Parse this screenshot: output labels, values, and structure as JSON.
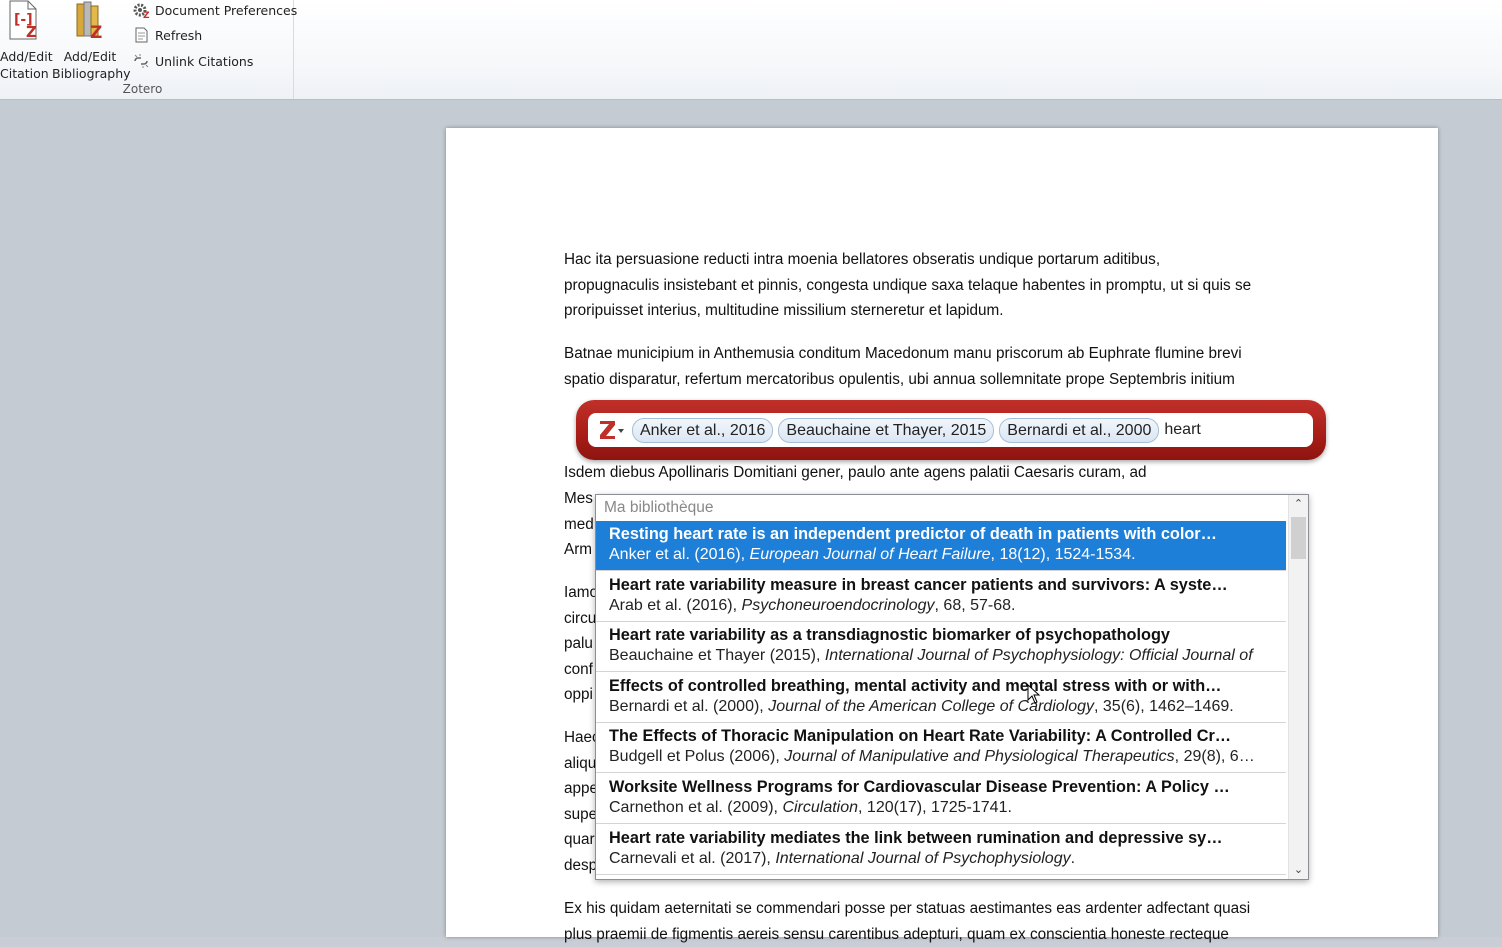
{
  "ribbon": {
    "add_citation": [
      "Add/Edit",
      "Citation"
    ],
    "add_bibliography": [
      "Add/Edit",
      "Bibliography"
    ],
    "document_preferences": "Document Preferences",
    "refresh": "Refresh",
    "unlink_citations": "Unlink Citations",
    "group_label": "Zotero"
  },
  "document": {
    "paragraphs": [
      [
        "Hac ita persuasione reducti intra moenia bellatores obseratis undique portarum aditibus,",
        "propugnaculis insistebant et pinnis, congesta undique saxa telaque habentes in promptu, ut si quis se",
        "proripuisset interius, multitudine missilium sterneretur et lapidum."
      ],
      [
        "Batnae municipium in Anthemusia conditum Macedonum manu priscorum ab Euphrate flumine brevi",
        "spatio disparatur, refertum mercatoribus opulentis, ubi annua sollemnitate prope Septembris initium"
      ],
      [
        "Isdem diebus Apollinaris Domitiani gener, paulo ante agens palatii Caesaris curam, ad"
      ],
      [
        "Ex his quidam aeternitati se commendari posse per statuas aestimantes eas ardenter adfectant quasi",
        "plus praemii de figmentis aereis sensu carentibus adepturi, quam ex conscientia honeste recteque"
      ]
    ],
    "left_fragments": [
      "Mes",
      "med",
      "Arm",
      "Iamo",
      "circu",
      "palu",
      "conf",
      "oppi",
      "Haec",
      "aliqu",
      "appe",
      "supe",
      "quar",
      "desp"
    ]
  },
  "quick_format": {
    "logo": "Z",
    "citations": [
      "Anker et al., 2016",
      "Beauchaine et Thayer, 2015",
      "Bernardi et al., 2000"
    ],
    "query": "heart"
  },
  "results": {
    "library": "Ma bibliothèque",
    "items": [
      {
        "title": "Resting heart rate is an independent predictor of death in patients with color…",
        "authors": "Anker et al. (2016), ",
        "journal": "European Journal of Heart Failure",
        "rest": ", 18(12), 1524-1534.",
        "selected": true
      },
      {
        "title": "Heart rate variability measure in breast cancer patients and survivors: A syste…",
        "authors": "Arab et al. (2016), ",
        "journal": "Psychoneuroendocrinology",
        "rest": ", 68, 57-68.",
        "selected": false
      },
      {
        "title": "Heart rate variability as a transdiagnostic biomarker of psychopathology",
        "authors": "Beauchaine et Thayer (2015), ",
        "journal": "International Journal of Psychophysiology: Official Journal of",
        "rest": "",
        "selected": false
      },
      {
        "title": "Effects of controlled breathing, mental activity and mental stress with or with…",
        "authors": "Bernardi et al. (2000), ",
        "journal": "Journal of the American College of Cardiology",
        "rest": ", 35(6), 1462–1469.",
        "selected": false
      },
      {
        "title": "The Effects of Thoracic Manipulation on Heart Rate Variability: A Controlled Cr…",
        "authors": "Budgell et Polus (2006), ",
        "journal": "Journal of Manipulative and Physiological Therapeutics",
        "rest": ", 29(8), 6…",
        "selected": false
      },
      {
        "title": "Worksite Wellness Programs for Cardiovascular Disease Prevention: A Policy …",
        "authors": "Carnethon et al. (2009), ",
        "journal": "Circulation",
        "rest": ", 120(17), 1725-1741.",
        "selected": false
      },
      {
        "title": "Heart rate variability mediates the link between rumination and depressive sy…",
        "authors": "Carnevali et al. (2017), ",
        "journal": "International Journal of Psychophysiology",
        "rest": ".",
        "selected": false
      }
    ]
  },
  "colors": {
    "selection": "#1e7fd9",
    "zotero_red": "#b0221c"
  }
}
